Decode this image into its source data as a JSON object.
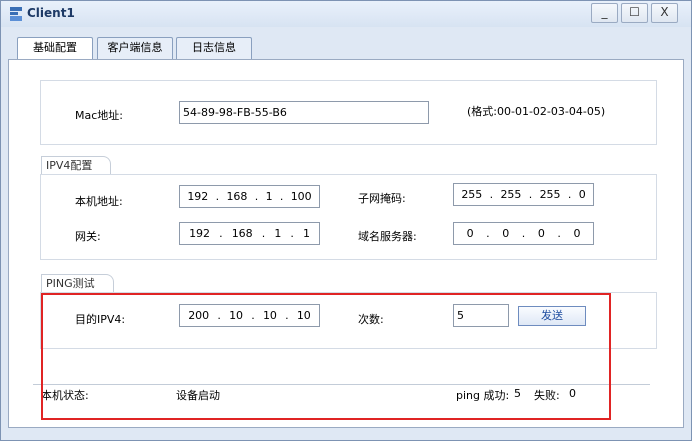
{
  "window": {
    "title": "Client1",
    "controls": {
      "minimize": "_",
      "maximize": "☐",
      "close": "X"
    }
  },
  "tabs": [
    {
      "label": "基础配置"
    },
    {
      "label": "客户端信息"
    },
    {
      "label": "日志信息"
    }
  ],
  "mac": {
    "label": "Mac地址:",
    "value": "54-89-98-FB-55-B6",
    "format_hint": "(格式:00-01-02-03-04-05)"
  },
  "ipv4": {
    "group_title": "IPV4配置",
    "host_label": "本机地址:",
    "host": [
      "192",
      "168",
      "1",
      "100"
    ],
    "mask_label": "子网掩码:",
    "mask": [
      "255",
      "255",
      "255",
      "0"
    ],
    "gateway_label": "网关:",
    "gateway": [
      "192",
      "168",
      "1",
      "1"
    ],
    "dns_label": "域名服务器:",
    "dns": [
      "0",
      "0",
      "0",
      "0"
    ]
  },
  "ping": {
    "group_title": "PING测试",
    "target_label": "目的IPV4:",
    "target": [
      "200",
      "10",
      "10",
      "10"
    ],
    "count_label": "次数:",
    "count": "5",
    "send_label": "发送"
  },
  "status": {
    "label": "本机状态:",
    "value": "设备启动",
    "success_label": "ping 成功:",
    "success": "5",
    "fail_label": "失败:",
    "fail": "0"
  },
  "colors": {
    "highlight": "#e02424",
    "window_bg": "#dfe8f4"
  }
}
